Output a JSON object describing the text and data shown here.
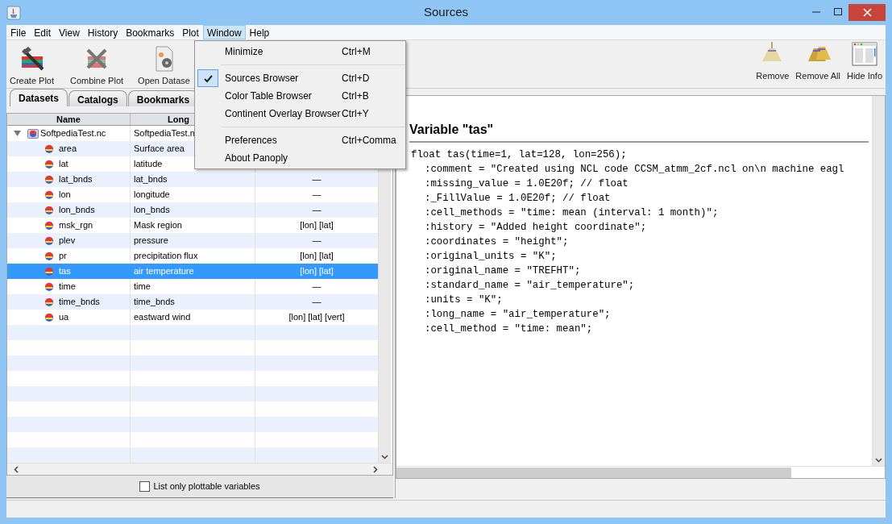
{
  "window": {
    "title": "Sources"
  },
  "menu_bar": [
    {
      "label": "File",
      "selected": false
    },
    {
      "label": "Edit",
      "selected": false
    },
    {
      "label": "View",
      "selected": false
    },
    {
      "label": "History",
      "selected": false
    },
    {
      "label": "Bookmarks",
      "selected": false
    },
    {
      "label": "Plot",
      "selected": false
    },
    {
      "label": "Window",
      "selected": true
    },
    {
      "label": "Help",
      "selected": false
    }
  ],
  "window_menu": [
    {
      "kind": "item",
      "label": "Minimize",
      "shortcut": "Ctrl+M",
      "checked": false
    },
    {
      "kind": "separator"
    },
    {
      "kind": "item",
      "label": "Sources Browser",
      "shortcut": "Ctrl+D",
      "checked": true
    },
    {
      "kind": "item",
      "label": "Color Table Browser",
      "shortcut": "Ctrl+B",
      "checked": false
    },
    {
      "kind": "item",
      "label": "Continent Overlay Browser",
      "shortcut": "Ctrl+Y",
      "checked": false
    },
    {
      "kind": "separator"
    },
    {
      "kind": "item",
      "label": "Preferences",
      "shortcut": "Ctrl+Comma",
      "checked": false
    },
    {
      "kind": "item",
      "label": "About Panoply",
      "checked": false
    }
  ],
  "toolbar": [
    {
      "kind": "create",
      "label": "Create Plot"
    },
    {
      "kind": "combine",
      "label": "Combine Plot"
    },
    {
      "kind": "open",
      "label": "Open Datase"
    }
  ],
  "info_toolbar": [
    {
      "kind": "remove",
      "label": "Remove"
    },
    {
      "kind": "remove_all",
      "label": "Remove All"
    },
    {
      "kind": "hide_info",
      "label": "Hide Info"
    }
  ],
  "tabs": [
    {
      "label": "Datasets",
      "selected": true
    },
    {
      "label": "Catalogs",
      "selected": false
    },
    {
      "label": "Bookmarks",
      "selected": false
    }
  ],
  "table": {
    "columns": [
      "Name",
      "Long"
    ],
    "rows": [
      {
        "name": "SoftpediaTest.nc",
        "long_name": "SoftpediaTest.n",
        "expanded": true,
        "selected": false,
        "children": [
          {
            "name": "area",
            "long_name": "Surface area",
            "selected": false
          },
          {
            "name": "lat",
            "long_name": "latitude",
            "selected": false
          },
          {
            "name": "lat_bnds",
            "long_name": "lat_bnds",
            "dimensions": "—",
            "selected": false
          },
          {
            "name": "lon",
            "long_name": "longitude",
            "dimensions": "—",
            "selected": false
          },
          {
            "name": "lon_bnds",
            "long_name": "lon_bnds",
            "dimensions": "—",
            "selected": false
          },
          {
            "name": "msk_rgn",
            "long_name": "Mask region",
            "dimensions": "[lon] [lat]",
            "selected": false
          },
          {
            "name": "plev",
            "long_name": "pressure",
            "dimensions": "—",
            "selected": false
          },
          {
            "name": "pr",
            "long_name": "precipitation flux",
            "dimensions": "[lon] [lat]",
            "selected": false
          },
          {
            "name": "tas",
            "long_name": "air temperature",
            "dimensions": "[lon] [lat]",
            "selected": true
          },
          {
            "name": "time",
            "long_name": "time",
            "dimensions": "—",
            "selected": false
          },
          {
            "name": "time_bnds",
            "long_name": "time_bnds",
            "dimensions": "—",
            "selected": false
          },
          {
            "name": "ua",
            "long_name": "eastward wind",
            "dimensions": "[lon] [lat] [vert]",
            "selected": false
          }
        ]
      }
    ]
  },
  "filter_checkbox": {
    "label": "List only plottable variables",
    "checked": false
  },
  "info": {
    "heading": "Variable \"tas\"",
    "declaration": "float tas(time=1, lat=128, lon=256);",
    "attributes": [
      ":comment = \"Created using NCL code CCSM_atmm_2cf.ncl on\\n machine eagl",
      ":missing_value = 1.0E20f; // float",
      ":_FillValue = 1.0E20f; // float",
      ":cell_methods = \"time: mean (interval: 1 month)\";",
      ":history = \"Added height coordinate\";",
      ":coordinates = \"height\";",
      ":original_units = \"K\";",
      ":original_name = \"TREFHT\";",
      ":standard_name = \"air_temperature\";",
      ":units = \"K\";",
      ":long_name = \"air_temperature\";",
      ":cell_method = \"time: mean\";"
    ]
  }
}
